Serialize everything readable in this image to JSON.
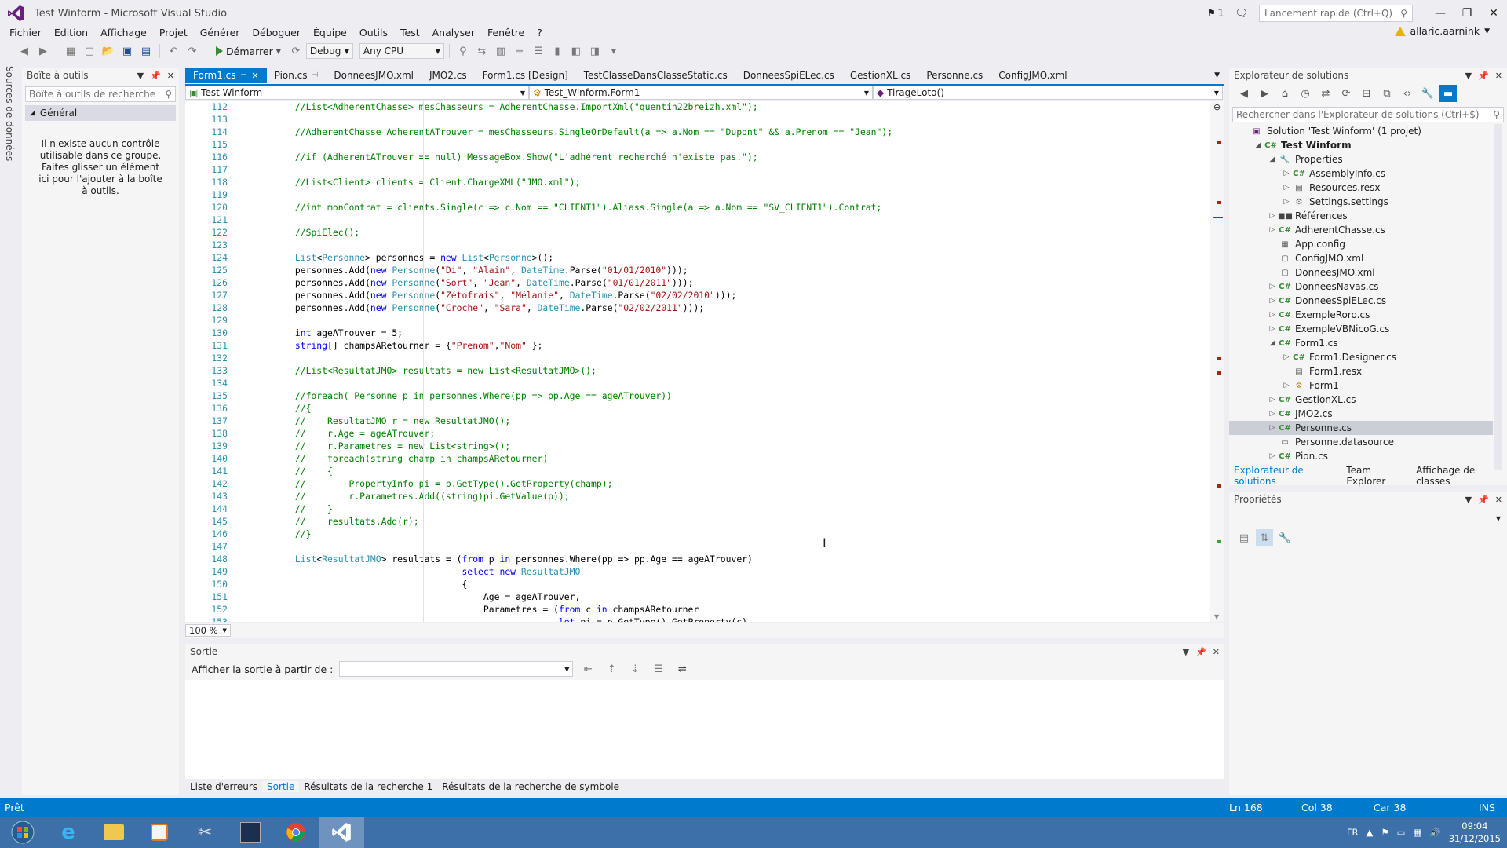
{
  "window": {
    "title": "Test Winform - Microsoft Visual Studio",
    "notif_count": "1"
  },
  "quicklaunch": {
    "placeholder": "Lancement rapide (Ctrl+Q)"
  },
  "menu": [
    "Fichier",
    "Edition",
    "Affichage",
    "Projet",
    "Générer",
    "Déboguer",
    "Équipe",
    "Outils",
    "Test",
    "Analyser",
    "Fenêtre",
    "?"
  ],
  "user": {
    "name": "allaric.aarnink"
  },
  "toolbar": {
    "start_label": "Démarrer",
    "config": "Debug",
    "platform": "Any CPU"
  },
  "left_strip": {
    "label": "Sources de données"
  },
  "toolbox": {
    "title": "Boîte à outils",
    "search_placeholder": "Boîte à outils de recherche",
    "group": "Général",
    "empty_message": "Il n'existe aucun contrôle utilisable dans ce groupe. Faites glisser un élément ici pour l'ajouter à la boîte à outils."
  },
  "tabs": [
    {
      "label": "Form1.cs",
      "active": true
    },
    {
      "label": "Pion.cs"
    },
    {
      "label": "DonneesJMO.xml"
    },
    {
      "label": "JMO2.cs"
    },
    {
      "label": "Form1.cs [Design]"
    },
    {
      "label": "TestClasseDansClasseStatic.cs"
    },
    {
      "label": "DonneesSpiELec.cs"
    },
    {
      "label": "GestionXL.cs"
    },
    {
      "label": "Personne.cs"
    },
    {
      "label": "ConfigJMO.xml"
    }
  ],
  "nav": {
    "project": "Test Winform",
    "class": "Test_Winform.Form1",
    "member": "TirageLoto()"
  },
  "code_lines": [
    {
      "n": "112",
      "t": "        //List<AdherentChasse> mesChasseurs = AdherentChasse.ImportXml(\"quentin22breizh.xml\");",
      "c": "cm"
    },
    {
      "n": "113",
      "t": "",
      "c": ""
    },
    {
      "n": "114",
      "t": "        //AdherentChasse AdherentATrouver = mesChasseurs.SingleOrDefault(a => a.Nom == \"Dupont\" && a.Prenom == \"Jean\");",
      "c": "cm"
    },
    {
      "n": "115",
      "t": "",
      "c": ""
    },
    {
      "n": "116",
      "t": "        //if (AdherentATrouver == null) MessageBox.Show(\"L'adhérent recherché n'existe pas.\");",
      "c": "cm"
    },
    {
      "n": "117",
      "t": "",
      "c": ""
    },
    {
      "n": "118",
      "t": "        //List<Client> clients = Client.ChargeXML(\"JMO.xml\");",
      "c": "cm"
    },
    {
      "n": "119",
      "t": "",
      "c": ""
    },
    {
      "n": "120",
      "t": "        //int monContrat = clients.Single(c => c.Nom == \"CLIENT1\").Aliass.Single(a => a.Nom == \"SV_CLIENT1\").Contrat;",
      "c": "cm"
    },
    {
      "n": "121",
      "t": "",
      "c": ""
    },
    {
      "n": "122",
      "t": "        //SpiElec();",
      "c": "cm"
    },
    {
      "n": "123",
      "t": "",
      "c": ""
    },
    {
      "n": "124",
      "t": "        List<Personne> personnes = new List<Personne>();",
      "c": ""
    },
    {
      "n": "125",
      "t": "        personnes.Add(new Personne(\"Di\", \"Alain\", DateTime.Parse(\"01/01/2010\")));",
      "c": ""
    },
    {
      "n": "126",
      "t": "        personnes.Add(new Personne(\"Sort\", \"Jean\", DateTime.Parse(\"01/01/2011\")));",
      "c": ""
    },
    {
      "n": "127",
      "t": "        personnes.Add(new Personne(\"Zétofrais\", \"Mélanie\", DateTime.Parse(\"02/02/2010\")));",
      "c": ""
    },
    {
      "n": "128",
      "t": "        personnes.Add(new Personne(\"Croche\", \"Sara\", DateTime.Parse(\"02/02/2011\")));",
      "c": ""
    },
    {
      "n": "129",
      "t": "",
      "c": ""
    },
    {
      "n": "130",
      "t": "        int ageATrouver = 5;",
      "c": ""
    },
    {
      "n": "131",
      "t": "        string[] champsARetourner = {\"Prenom\",\"Nom\" };",
      "c": ""
    },
    {
      "n": "132",
      "t": "",
      "c": ""
    },
    {
      "n": "133",
      "t": "        //List<ResultatJMO> resultats = new List<ResultatJMO>();",
      "c": "cm"
    },
    {
      "n": "134",
      "t": "",
      "c": ""
    },
    {
      "n": "135",
      "t": "        //foreach( Personne p in personnes.Where(pp => pp.Age == ageATrouver))",
      "c": "cm"
    },
    {
      "n": "136",
      "t": "        //{",
      "c": "cm"
    },
    {
      "n": "137",
      "t": "        //    ResultatJMO r = new ResultatJMO();",
      "c": "cm"
    },
    {
      "n": "138",
      "t": "        //    r.Age = ageATrouver;",
      "c": "cm"
    },
    {
      "n": "139",
      "t": "        //    r.Parametres = new List<string>();",
      "c": "cm"
    },
    {
      "n": "140",
      "t": "        //    foreach(string champ in champsARetourner)",
      "c": "cm"
    },
    {
      "n": "141",
      "t": "        //    {",
      "c": "cm"
    },
    {
      "n": "142",
      "t": "        //        PropertyInfo pi = p.GetType().GetProperty(champ);",
      "c": "cm"
    },
    {
      "n": "143",
      "t": "        //        r.Parametres.Add((string)pi.GetValue(p));",
      "c": "cm"
    },
    {
      "n": "144",
      "t": "        //    }",
      "c": "cm"
    },
    {
      "n": "145",
      "t": "        //    resultats.Add(r);",
      "c": "cm"
    },
    {
      "n": "146",
      "t": "        //}",
      "c": "cm"
    },
    {
      "n": "147",
      "t": "",
      "c": ""
    },
    {
      "n": "148",
      "t": "        List<ResultatJMO> resultats = (from p in personnes.Where(pp => pp.Age == ageATrouver)",
      "c": ""
    },
    {
      "n": "149",
      "t": "                                       select new ResultatJMO",
      "c": ""
    },
    {
      "n": "150",
      "t": "                                       {",
      "c": ""
    },
    {
      "n": "151",
      "t": "                                           Age = ageATrouver,",
      "c": ""
    },
    {
      "n": "152",
      "t": "                                           Parametres = (from c in champsARetourner",
      "c": ""
    },
    {
      "n": "153",
      "t": "                                                         let pi = p.GetType().GetProperty(c)",
      "c": ""
    }
  ],
  "editor": {
    "zoom": "100 %"
  },
  "output": {
    "title": "Sortie",
    "source_label": "Afficher la sortie à partir de :"
  },
  "bottom_tabs": [
    "Liste d'erreurs",
    "Sortie",
    "Résultats de la recherche 1",
    "Résultats de la recherche de symbole"
  ],
  "solution_explorer": {
    "title": "Explorateur de solutions",
    "search_placeholder": "Rechercher dans l'Explorateur de solutions (Ctrl+$)",
    "items": [
      {
        "label": "Solution 'Test Winform' (1 projet)",
        "level": 0,
        "expand": "",
        "icon": "sln"
      },
      {
        "label": "Test Winform",
        "level": 1,
        "expand": "open",
        "icon": "proj",
        "bold": true
      },
      {
        "label": "Properties",
        "level": 2,
        "expand": "open",
        "icon": "wrench"
      },
      {
        "label": "AssemblyInfo.cs",
        "level": 3,
        "expand": "closed",
        "icon": "cs"
      },
      {
        "label": "Resources.resx",
        "level": 3,
        "expand": "closed",
        "icon": "resx"
      },
      {
        "label": "Settings.settings",
        "level": 3,
        "expand": "closed",
        "icon": "gear"
      },
      {
        "label": "Références",
        "level": 2,
        "expand": "closed",
        "icon": "ref"
      },
      {
        "label": "AdherentChasse.cs",
        "level": 2,
        "expand": "closed",
        "icon": "cs"
      },
      {
        "label": "App.config",
        "level": 2,
        "expand": "",
        "icon": "cfg"
      },
      {
        "label": "ConfigJMO.xml",
        "level": 2,
        "expand": "",
        "icon": "xml"
      },
      {
        "label": "DonneesJMO.xml",
        "level": 2,
        "expand": "",
        "icon": "xml"
      },
      {
        "label": "DonneesNavas.cs",
        "level": 2,
        "expand": "closed",
        "icon": "cs"
      },
      {
        "label": "DonneesSpiELec.cs",
        "level": 2,
        "expand": "closed",
        "icon": "cs"
      },
      {
        "label": "ExempleRoro.cs",
        "level": 2,
        "expand": "closed",
        "icon": "cs"
      },
      {
        "label": "ExempleVBNicoG.cs",
        "level": 2,
        "expand": "closed",
        "icon": "cs"
      },
      {
        "label": "Form1.cs",
        "level": 2,
        "expand": "open",
        "icon": "form"
      },
      {
        "label": "Form1.Designer.cs",
        "level": 3,
        "expand": "closed",
        "icon": "cs"
      },
      {
        "label": "Form1.resx",
        "level": 3,
        "expand": "",
        "icon": "resx"
      },
      {
        "label": "Form1",
        "level": 3,
        "expand": "closed",
        "icon": "class"
      },
      {
        "label": "GestionXL.cs",
        "level": 2,
        "expand": "closed",
        "icon": "cs"
      },
      {
        "label": "JMO2.cs",
        "level": 2,
        "expand": "closed",
        "icon": "cs"
      },
      {
        "label": "Personne.cs",
        "level": 2,
        "expand": "closed",
        "icon": "cs",
        "selected": true
      },
      {
        "label": "Personne.datasource",
        "level": 2,
        "expand": "",
        "icon": "ds"
      },
      {
        "label": "Pion.cs",
        "level": 2,
        "expand": "closed",
        "icon": "cs"
      }
    ],
    "tabs": [
      "Explorateur de solutions",
      "Team Explorer",
      "Affichage de classes"
    ]
  },
  "properties": {
    "title": "Propriétés"
  },
  "status": {
    "ready": "Prêt",
    "line": "Ln 168",
    "col": "Col 38",
    "car": "Car 38",
    "mode": "INS"
  },
  "taskbar": {
    "lang": "FR",
    "time": "09:04",
    "date": "31/12/2015"
  },
  "colors": {
    "accent": "#007acc",
    "taskbar": "#3d6fa8",
    "comment": "#008000",
    "keyword": "#0000ff",
    "type": "#2b91af",
    "string": "#a31515"
  }
}
